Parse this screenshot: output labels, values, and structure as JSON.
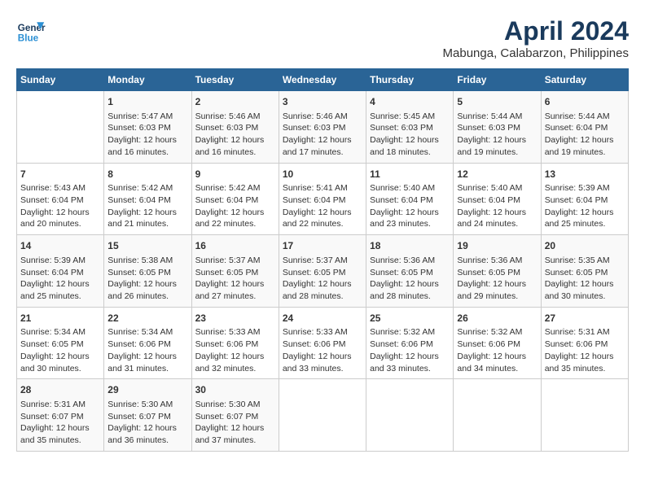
{
  "header": {
    "logo_line1": "General",
    "logo_line2": "Blue",
    "title": "April 2024",
    "subtitle": "Mabunga, Calabarzon, Philippines"
  },
  "calendar": {
    "days_of_week": [
      "Sunday",
      "Monday",
      "Tuesday",
      "Wednesday",
      "Thursday",
      "Friday",
      "Saturday"
    ],
    "weeks": [
      [
        {
          "num": "",
          "sunrise": "",
          "sunset": "",
          "daylight": ""
        },
        {
          "num": "1",
          "sunrise": "Sunrise: 5:47 AM",
          "sunset": "Sunset: 6:03 PM",
          "daylight": "Daylight: 12 hours and 16 minutes."
        },
        {
          "num": "2",
          "sunrise": "Sunrise: 5:46 AM",
          "sunset": "Sunset: 6:03 PM",
          "daylight": "Daylight: 12 hours and 16 minutes."
        },
        {
          "num": "3",
          "sunrise": "Sunrise: 5:46 AM",
          "sunset": "Sunset: 6:03 PM",
          "daylight": "Daylight: 12 hours and 17 minutes."
        },
        {
          "num": "4",
          "sunrise": "Sunrise: 5:45 AM",
          "sunset": "Sunset: 6:03 PM",
          "daylight": "Daylight: 12 hours and 18 minutes."
        },
        {
          "num": "5",
          "sunrise": "Sunrise: 5:44 AM",
          "sunset": "Sunset: 6:03 PM",
          "daylight": "Daylight: 12 hours and 19 minutes."
        },
        {
          "num": "6",
          "sunrise": "Sunrise: 5:44 AM",
          "sunset": "Sunset: 6:04 PM",
          "daylight": "Daylight: 12 hours and 19 minutes."
        }
      ],
      [
        {
          "num": "7",
          "sunrise": "Sunrise: 5:43 AM",
          "sunset": "Sunset: 6:04 PM",
          "daylight": "Daylight: 12 hours and 20 minutes."
        },
        {
          "num": "8",
          "sunrise": "Sunrise: 5:42 AM",
          "sunset": "Sunset: 6:04 PM",
          "daylight": "Daylight: 12 hours and 21 minutes."
        },
        {
          "num": "9",
          "sunrise": "Sunrise: 5:42 AM",
          "sunset": "Sunset: 6:04 PM",
          "daylight": "Daylight: 12 hours and 22 minutes."
        },
        {
          "num": "10",
          "sunrise": "Sunrise: 5:41 AM",
          "sunset": "Sunset: 6:04 PM",
          "daylight": "Daylight: 12 hours and 22 minutes."
        },
        {
          "num": "11",
          "sunrise": "Sunrise: 5:40 AM",
          "sunset": "Sunset: 6:04 PM",
          "daylight": "Daylight: 12 hours and 23 minutes."
        },
        {
          "num": "12",
          "sunrise": "Sunrise: 5:40 AM",
          "sunset": "Sunset: 6:04 PM",
          "daylight": "Daylight: 12 hours and 24 minutes."
        },
        {
          "num": "13",
          "sunrise": "Sunrise: 5:39 AM",
          "sunset": "Sunset: 6:04 PM",
          "daylight": "Daylight: 12 hours and 25 minutes."
        }
      ],
      [
        {
          "num": "14",
          "sunrise": "Sunrise: 5:39 AM",
          "sunset": "Sunset: 6:04 PM",
          "daylight": "Daylight: 12 hours and 25 minutes."
        },
        {
          "num": "15",
          "sunrise": "Sunrise: 5:38 AM",
          "sunset": "Sunset: 6:05 PM",
          "daylight": "Daylight: 12 hours and 26 minutes."
        },
        {
          "num": "16",
          "sunrise": "Sunrise: 5:37 AM",
          "sunset": "Sunset: 6:05 PM",
          "daylight": "Daylight: 12 hours and 27 minutes."
        },
        {
          "num": "17",
          "sunrise": "Sunrise: 5:37 AM",
          "sunset": "Sunset: 6:05 PM",
          "daylight": "Daylight: 12 hours and 28 minutes."
        },
        {
          "num": "18",
          "sunrise": "Sunrise: 5:36 AM",
          "sunset": "Sunset: 6:05 PM",
          "daylight": "Daylight: 12 hours and 28 minutes."
        },
        {
          "num": "19",
          "sunrise": "Sunrise: 5:36 AM",
          "sunset": "Sunset: 6:05 PM",
          "daylight": "Daylight: 12 hours and 29 minutes."
        },
        {
          "num": "20",
          "sunrise": "Sunrise: 5:35 AM",
          "sunset": "Sunset: 6:05 PM",
          "daylight": "Daylight: 12 hours and 30 minutes."
        }
      ],
      [
        {
          "num": "21",
          "sunrise": "Sunrise: 5:34 AM",
          "sunset": "Sunset: 6:05 PM",
          "daylight": "Daylight: 12 hours and 30 minutes."
        },
        {
          "num": "22",
          "sunrise": "Sunrise: 5:34 AM",
          "sunset": "Sunset: 6:06 PM",
          "daylight": "Daylight: 12 hours and 31 minutes."
        },
        {
          "num": "23",
          "sunrise": "Sunrise: 5:33 AM",
          "sunset": "Sunset: 6:06 PM",
          "daylight": "Daylight: 12 hours and 32 minutes."
        },
        {
          "num": "24",
          "sunrise": "Sunrise: 5:33 AM",
          "sunset": "Sunset: 6:06 PM",
          "daylight": "Daylight: 12 hours and 33 minutes."
        },
        {
          "num": "25",
          "sunrise": "Sunrise: 5:32 AM",
          "sunset": "Sunset: 6:06 PM",
          "daylight": "Daylight: 12 hours and 33 minutes."
        },
        {
          "num": "26",
          "sunrise": "Sunrise: 5:32 AM",
          "sunset": "Sunset: 6:06 PM",
          "daylight": "Daylight: 12 hours and 34 minutes."
        },
        {
          "num": "27",
          "sunrise": "Sunrise: 5:31 AM",
          "sunset": "Sunset: 6:06 PM",
          "daylight": "Daylight: 12 hours and 35 minutes."
        }
      ],
      [
        {
          "num": "28",
          "sunrise": "Sunrise: 5:31 AM",
          "sunset": "Sunset: 6:07 PM",
          "daylight": "Daylight: 12 hours and 35 minutes."
        },
        {
          "num": "29",
          "sunrise": "Sunrise: 5:30 AM",
          "sunset": "Sunset: 6:07 PM",
          "daylight": "Daylight: 12 hours and 36 minutes."
        },
        {
          "num": "30",
          "sunrise": "Sunrise: 5:30 AM",
          "sunset": "Sunset: 6:07 PM",
          "daylight": "Daylight: 12 hours and 37 minutes."
        },
        {
          "num": "",
          "sunrise": "",
          "sunset": "",
          "daylight": ""
        },
        {
          "num": "",
          "sunrise": "",
          "sunset": "",
          "daylight": ""
        },
        {
          "num": "",
          "sunrise": "",
          "sunset": "",
          "daylight": ""
        },
        {
          "num": "",
          "sunrise": "",
          "sunset": "",
          "daylight": ""
        }
      ]
    ]
  }
}
